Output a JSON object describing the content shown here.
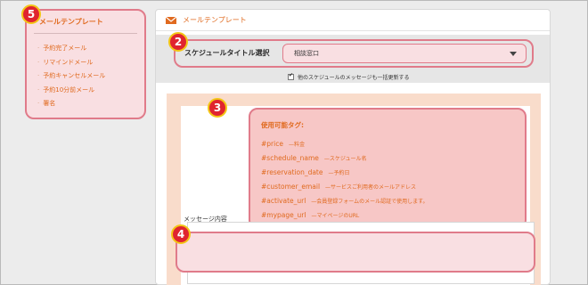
{
  "sidebar": {
    "title": "メールテンプレート",
    "items": [
      {
        "label": "予約完了メール"
      },
      {
        "label": "リマインドメール"
      },
      {
        "label": "予約キャンセルメール"
      },
      {
        "label": "予約10分前メール"
      },
      {
        "label": "署名"
      }
    ]
  },
  "panel": {
    "title": "メールテンプレート",
    "mail_icon": "envelope-icon"
  },
  "schedule_select": {
    "label": "スケジュールタイトル選択",
    "value": "相談窓口",
    "bulk_update_label": "他のスケジュールのメッセージも一括更新する",
    "bulk_update_checked": true
  },
  "tags": {
    "heading": "使用可能タグ:",
    "items": [
      {
        "tag": "#price",
        "desc": "—料金"
      },
      {
        "tag": "#schedule_name",
        "desc": "—スケジュール名"
      },
      {
        "tag": "#reservation_date",
        "desc": "—予約日"
      },
      {
        "tag": "#customer_email",
        "desc": "—サービスご利用者のメールアドレス"
      },
      {
        "tag": "#activate_url",
        "desc": "—会員登録フォームのメール認証で使用します。"
      },
      {
        "tag": "#mypage_url",
        "desc": "—マイページのURL"
      }
    ]
  },
  "message": {
    "label": "メッセージ内容",
    "value": ""
  },
  "badges": {
    "sidebar": "5",
    "schedule": "2",
    "tags": "3",
    "message": "4"
  },
  "colors": {
    "accent_orange": "#e06a1f",
    "highlight_border": "#e07b8a",
    "highlight_fill": "#f9dfe2",
    "badge_red": "#e0242f",
    "badge_ring": "#f3c515"
  }
}
